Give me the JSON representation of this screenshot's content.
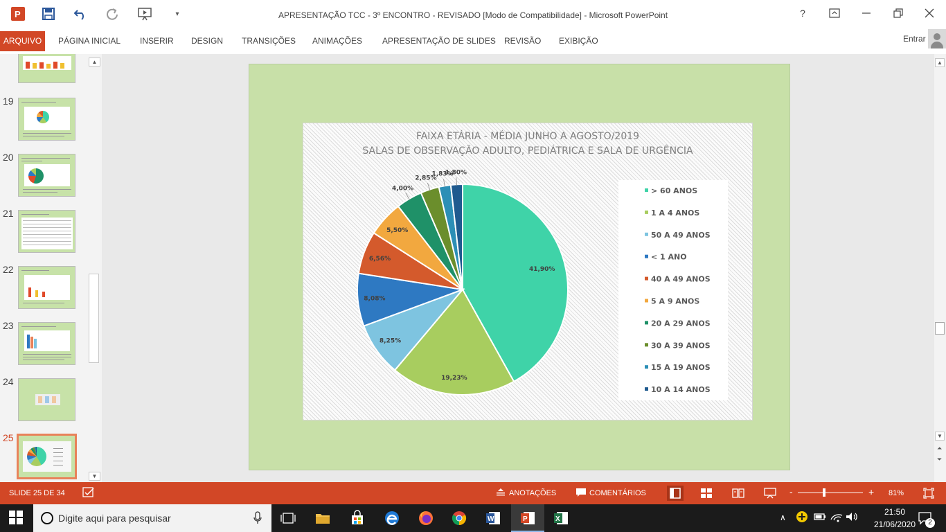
{
  "window": {
    "title": "APRESENTAÇÃO TCC - 3º ENCONTRO - REVISADO [Modo de Compatibilidade] - Microsoft PowerPoint",
    "help": "?",
    "signin": "Entrar"
  },
  "ribbon": {
    "tabs": [
      "ARQUIVO",
      "PÁGINA INICIAL",
      "INSERIR",
      "DESIGN",
      "TRANSIÇÕES",
      "ANIMAÇÕES",
      "APRESENTAÇÃO DE SLIDES",
      "REVISÃO",
      "EXIBIÇÃO"
    ]
  },
  "thumbnails": {
    "numbers": [
      "19",
      "20",
      "21",
      "22",
      "23",
      "24",
      "25"
    ],
    "active": "25"
  },
  "colors": {
    "accent": "#d24726",
    "slide_bg": "#c8e0a8"
  },
  "chart_data": {
    "type": "pie",
    "title": "FAIXA ETÁRIA - MÉDIA JUNHO A AGOSTO/2019",
    "subtitle": "SALAS DE OBSERVAÇÃO ADULTO, PEDIÁTRICA E SALA DE URGÊNCIA",
    "legend_position": "right",
    "slices": [
      {
        "label": "> 60 ANOS",
        "value": 41.9,
        "text": "41,90%",
        "color": "#3fd3a8"
      },
      {
        "label": "1 A 4 ANOS",
        "value": 19.23,
        "text": "19,23%",
        "color": "#a8cd5f"
      },
      {
        "label": "50 A 49 ANOS",
        "value": 8.25,
        "text": "8,25%",
        "color": "#7ec4e0"
      },
      {
        "label": "< 1 ANO",
        "value": 8.08,
        "text": "8,08%",
        "color": "#2e79c2"
      },
      {
        "label": "40 A 49 ANOS",
        "value": 6.56,
        "text": "6,56%",
        "color": "#d45a2c"
      },
      {
        "label": "5 A 9 ANOS",
        "value": 5.5,
        "text": "5,50%",
        "color": "#f2a83f"
      },
      {
        "label": "20 A 29 ANOS",
        "value": 4.0,
        "text": "4,00%",
        "color": "#1f9168"
      },
      {
        "label": "30 A 39 ANOS",
        "value": 2.85,
        "text": "2,85%",
        "color": "#6b8e2c"
      },
      {
        "label": "15 A 19 ANOS",
        "value": 1.83,
        "text": "1,83%",
        "color": "#2c8fb6"
      },
      {
        "label": "10 A 14 ANOS",
        "value": 1.8,
        "text": "1,80%",
        "color": "#1f5a8f"
      }
    ]
  },
  "status": {
    "slide": "SLIDE 25 DE 34",
    "notes": "ANOTAÇÕES",
    "comments": "COMENTÁRIOS",
    "zoom_minus": "-",
    "zoom_plus": "+",
    "zoom": "81%",
    "zoom_level": 0.4
  },
  "taskbar": {
    "search_placeholder": "Digite aqui para pesquisar",
    "time": "21:50",
    "date": "21/06/2020",
    "notification_count": "2"
  }
}
